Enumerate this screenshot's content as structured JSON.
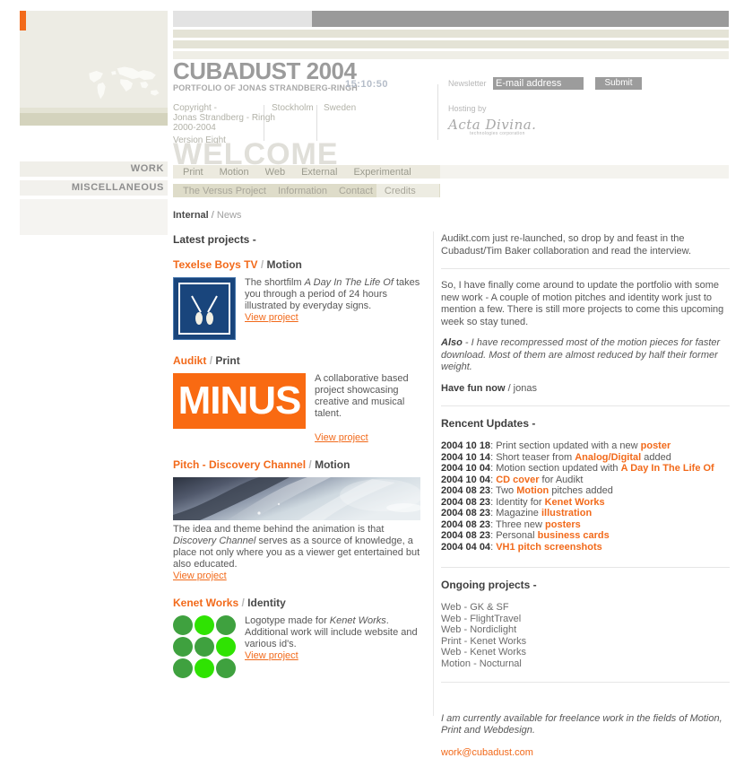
{
  "sidebar": {
    "accent_color": "#f26a1b",
    "map_icon": "world-map-icon",
    "links": [
      {
        "label": "WORK"
      },
      {
        "label": "MISCELLANEOUS"
      }
    ]
  },
  "header": {
    "title": "CUBADUST 2004",
    "subtitle": "PORTFOLIO OF JONAS STRANDBERG-RINGH",
    "clock": "15:10:50",
    "copyright_line1": "Copyright -",
    "copyright_line2": "Jonas Strandberg - Ringh",
    "copyright_line3": "2000-2004",
    "city": "Stockholm",
    "country": "Sweden",
    "version": "Version Eight",
    "watermark": "WELCOME"
  },
  "newsletter": {
    "label": "Newsletter",
    "placeholder": "E-mail address",
    "value": "E-mail address",
    "submit_label": "Submit",
    "hosting_label": "Hosting by",
    "host_name": "Acta Divina.",
    "host_tagline": "technologies corporation"
  },
  "nav": {
    "primary": [
      {
        "label": "Print"
      },
      {
        "label": "Motion"
      },
      {
        "label": "Web"
      },
      {
        "label": "External"
      },
      {
        "label": "Experimental"
      }
    ],
    "secondary": [
      {
        "label": "The Versus Project"
      },
      {
        "label": "Information"
      },
      {
        "label": "Contact"
      },
      {
        "label": "Credits"
      }
    ]
  },
  "breadcrumb": {
    "root": "Internal",
    "separator": "/",
    "current": "News"
  },
  "projects": {
    "heading": "Latest projects -",
    "view_label": "View project",
    "items": [
      {
        "name": "Texelse Boys TV",
        "slash": "/",
        "category": "Motion",
        "thumb": "texelse-logo-icon",
        "desc_before": "The shortfilm ",
        "desc_italic": "A Day In The Life Of",
        "desc_after": " takes you through a period of 24 hours illustrated by everyday signs."
      },
      {
        "name": "Audikt",
        "slash": "/",
        "category": "Print",
        "thumb": "minus-banner-image",
        "banner_text": "MINUS",
        "desc_before": "A collaborative based project showcasing creative and musical talent.",
        "desc_italic": "",
        "desc_after": ""
      },
      {
        "name": "Pitch - Discovery Channel",
        "slash": "/",
        "category": "Motion",
        "thumb": "discovery-channel-still-image",
        "desc_before": "The idea and theme behind the animation is that ",
        "desc_italic": "Discovery Channel",
        "desc_after": " serves as a source of knowledge, a place not only where you as a viewer get entertained but also educated."
      },
      {
        "name": "Kenet Works",
        "slash": "/",
        "category": "Identity",
        "thumb": "kenet-works-dots-logo",
        "desc_before": "Logotype made for ",
        "desc_italic": "Kenet Works",
        "desc_after": ". Additional work will include website and various id's."
      }
    ]
  },
  "news": {
    "intro": "Audikt.com just re-launched, so drop by and feast in the Cubadust/Tim Baker collaboration and read the interview.",
    "body": "So, I have finally come around to update the portfolio with some new work - A couple of motion pitches and identity work just to mention a few. There is still more projects to come this upcoming week so stay tuned.",
    "also_label": "Also",
    "also_text": " - I have recompressed most of the motion pieces for faster download. Most of them are almost reduced by half their former weight.",
    "signoff_bold": "Have fun now",
    "signoff_rest": " / jonas"
  },
  "updates": {
    "heading": "Rencent Updates -",
    "items": [
      {
        "date": "2004 10 18",
        "before": "Print section updated with a new ",
        "highlight": "poster",
        "after": ""
      },
      {
        "date": "2004 10 14",
        "before": "Short teaser from ",
        "highlight": "Analog/Digital",
        "after": " added"
      },
      {
        "date": "2004 10 04",
        "before": "Motion section updated with ",
        "highlight": "A Day In The Life Of",
        "after": ""
      },
      {
        "date": "2004 10 04",
        "before": "",
        "highlight": "CD cover",
        "after": " for Audikt"
      },
      {
        "date": "2004 08 23",
        "before": "Two ",
        "highlight": "Motion",
        "after": " pitches added"
      },
      {
        "date": "2004 08 23",
        "before": "Identity for ",
        "highlight": "Kenet Works",
        "after": ""
      },
      {
        "date": "2004 08 23",
        "before": "Magazine ",
        "highlight": "illustration",
        "after": ""
      },
      {
        "date": "2004 08 23",
        "before": "Three new ",
        "highlight": "posters",
        "after": ""
      },
      {
        "date": "2004 08 23",
        "before": "Personal ",
        "highlight": "business cards",
        "after": ""
      },
      {
        "date": "2004 04 04",
        "before": "",
        "highlight": "VH1 pitch screenshots",
        "after": ""
      }
    ]
  },
  "ongoing": {
    "heading": "Ongoing projects -",
    "items": [
      "Web - GK & SF",
      "Web - FlightTravel",
      "Web - Nordiclight",
      "Print - Kenet Works",
      "Web - Kenet Works",
      "Motion - Nocturnal"
    ]
  },
  "footer": {
    "note": "I am currently available for freelance work in the fields of Motion, Print and Webdesign.",
    "email": "work@cubadust.com"
  }
}
